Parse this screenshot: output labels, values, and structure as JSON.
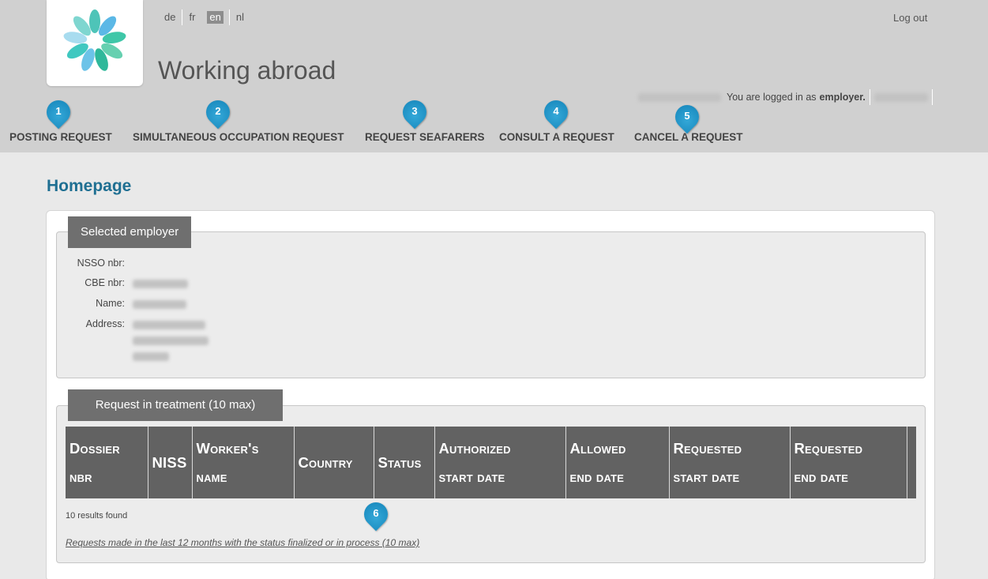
{
  "header": {
    "app_title": "Working abroad",
    "logout": "Log out",
    "languages": [
      "de",
      "fr",
      "en",
      "nl"
    ],
    "active_language": "en",
    "logged_prefix": "You are logged in as",
    "logged_role": "employer.",
    "logo_icon": "flower-logo-icon"
  },
  "nav": {
    "items": [
      {
        "label": "POSTING REQUEST",
        "marker": "1"
      },
      {
        "label": "SIMULTANEOUS OCCUPATION REQUEST",
        "marker": "2"
      },
      {
        "label": "REQUEST SEAFARERS",
        "marker": "3"
      },
      {
        "label": "CONSULT A REQUEST",
        "marker": "4"
      },
      {
        "label": "CANCEL A REQUEST",
        "marker": "5"
      }
    ],
    "marker_color": "#1e90c4"
  },
  "main": {
    "page_title": "Homepage",
    "employer": {
      "legend": "Selected employer",
      "nsso_label": "NSSO nbr:",
      "cbe_label": "CBE nbr:",
      "name_label": "Name:",
      "address_label": "Address:"
    },
    "requests": {
      "legend": "Request in treatment (10 max)",
      "columns": [
        [
          "Dossier",
          "nbr"
        ],
        [
          "NISS"
        ],
        [
          "Worker's",
          "name"
        ],
        [
          "Country"
        ],
        [
          "Status"
        ],
        [
          "Authorized",
          "start date"
        ],
        [
          "Allowed",
          "end date"
        ],
        [
          "Requested",
          "start date"
        ],
        [
          "Requested",
          "end date"
        ]
      ],
      "results": "10 results found",
      "marker": "6",
      "link": "Requests made in the last 12 months with the status finalized or in process (10 max)"
    }
  },
  "colors": {
    "title_blue": "#1f6f92",
    "header_gray": "#d0d0d0",
    "table_header": "#626262"
  }
}
